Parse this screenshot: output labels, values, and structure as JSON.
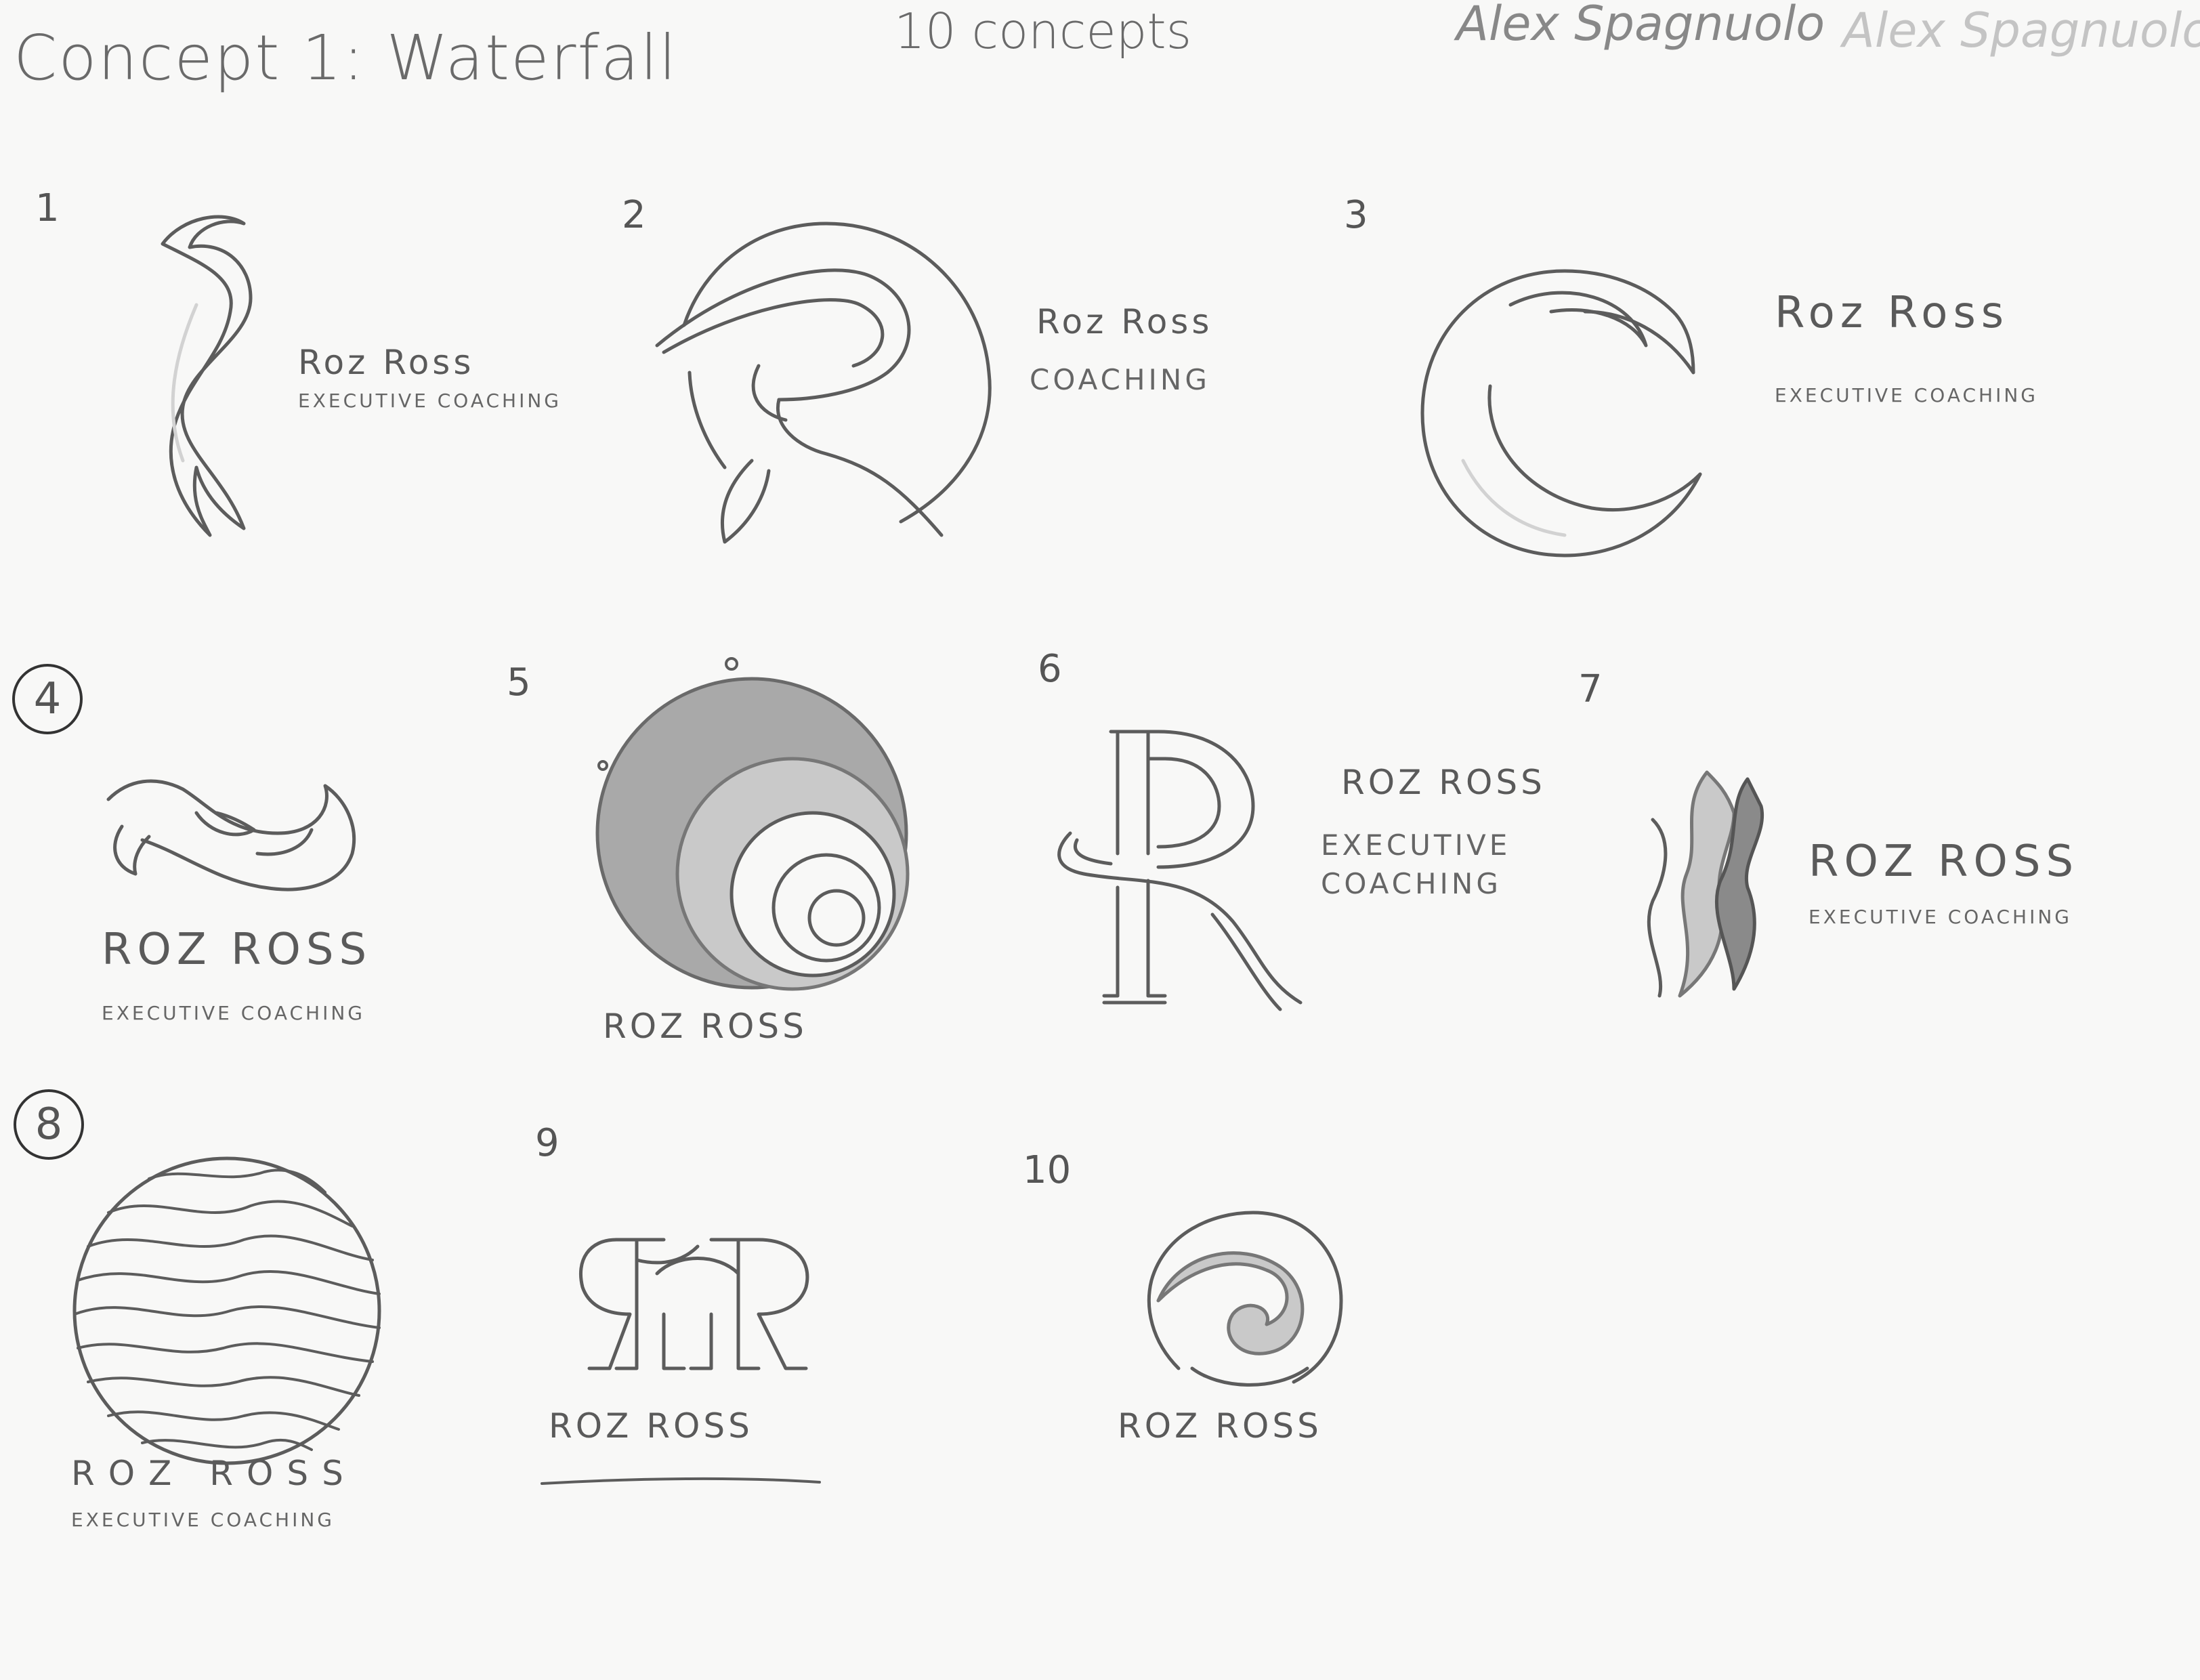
{
  "header": {
    "title": "Concept 1: Waterfall",
    "subtitle": "10 concepts",
    "signature": "Alex Spagnuolo",
    "signature_faint": "Alex Spagnuolo"
  },
  "concepts": [
    {
      "number": "1",
      "circled": false,
      "name": "Roz Ross",
      "tagline": "Executive Coaching",
      "mark": "s-stream-icon"
    },
    {
      "number": "2",
      "circled": false,
      "name": "Roz Ross",
      "tagline": "Coaching",
      "mark": "circle-r-icon"
    },
    {
      "number": "3",
      "circled": false,
      "name": "Roz Ross",
      "tagline": "Executive Coaching",
      "mark": "crescent-wave-icon"
    },
    {
      "number": "4",
      "circled": true,
      "name": "Roz Ross",
      "tagline": "Executive Coaching",
      "mark": "curling-wave-icon"
    },
    {
      "number": "5",
      "circled": false,
      "name": "Roz Ross",
      "tagline": "",
      "mark": "shaded-ripple-circle-icon"
    },
    {
      "number": "6",
      "circled": false,
      "name": "Roz Ross",
      "tagline": "Executive Coaching",
      "mark": "swash-r-icon"
    },
    {
      "number": "7",
      "circled": false,
      "name": "Roz Ross",
      "tagline": "Executive Coaching",
      "mark": "flame-streams-icon"
    },
    {
      "number": "8",
      "circled": true,
      "name": "Roz Ross",
      "tagline": "Executive Coaching",
      "mark": "striped-circle-icon"
    },
    {
      "number": "9",
      "circled": false,
      "name": "Roz Ross",
      "tagline": "",
      "mark": "twin-r-icon"
    },
    {
      "number": "10",
      "circled": false,
      "name": "Roz Ross",
      "tagline": "",
      "mark": "wave-badge-icon"
    }
  ]
}
